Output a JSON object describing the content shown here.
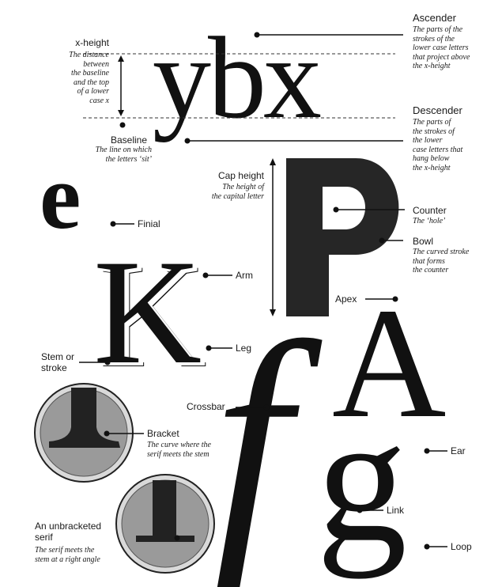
{
  "glyphs": {
    "ybx": "ybx",
    "e": "e",
    "P": "P",
    "K": "K",
    "A": "A",
    "f": "f",
    "g": "g"
  },
  "labels": {
    "ascender": {
      "term": "Ascender",
      "desc": "The parts of the\nstrokes of the\nlower case letters\nthat project above\nthe x-height"
    },
    "x_height": {
      "term": "x-height",
      "desc": "The distance\nbetween\nthe baseline\nand the top\nof a lower\ncase x"
    },
    "baseline": {
      "term": "Baseline",
      "desc": "The line on which\nthe letters ‘sit’"
    },
    "descender": {
      "term": "Descender",
      "desc": "The parts of\nthe strokes of\nthe lower\ncase letters that\nhang below\nthe x-height"
    },
    "cap_height": {
      "term": "Cap height",
      "desc": "The height of\nthe capital letter"
    },
    "finial": {
      "term": "Finial"
    },
    "counter": {
      "term": "Counter",
      "desc": "The ‘hole’"
    },
    "bowl": {
      "term": "Bowl",
      "desc": "The curved stroke\nthat forms\nthe counter"
    },
    "arm": {
      "term": "Arm"
    },
    "apex": {
      "term": "Apex"
    },
    "leg": {
      "term": "Leg"
    },
    "stem": {
      "term": "Stem or\nstroke"
    },
    "crossbar": {
      "term": "Crossbar"
    },
    "bracket": {
      "term": "Bracket",
      "desc": "The curve where the\nserif meets the stem"
    },
    "ear": {
      "term": "Ear"
    },
    "link": {
      "term": "Link"
    },
    "unbracketed": {
      "term": "An unbracketed\nserif",
      "desc": "The serif meets the\nstem at a right angle"
    },
    "loop": {
      "term": "Loop"
    }
  },
  "colors": {
    "ink": "#111111",
    "circle_fill": "#9a9a9a",
    "circle_ring": "#d9d9d9"
  }
}
